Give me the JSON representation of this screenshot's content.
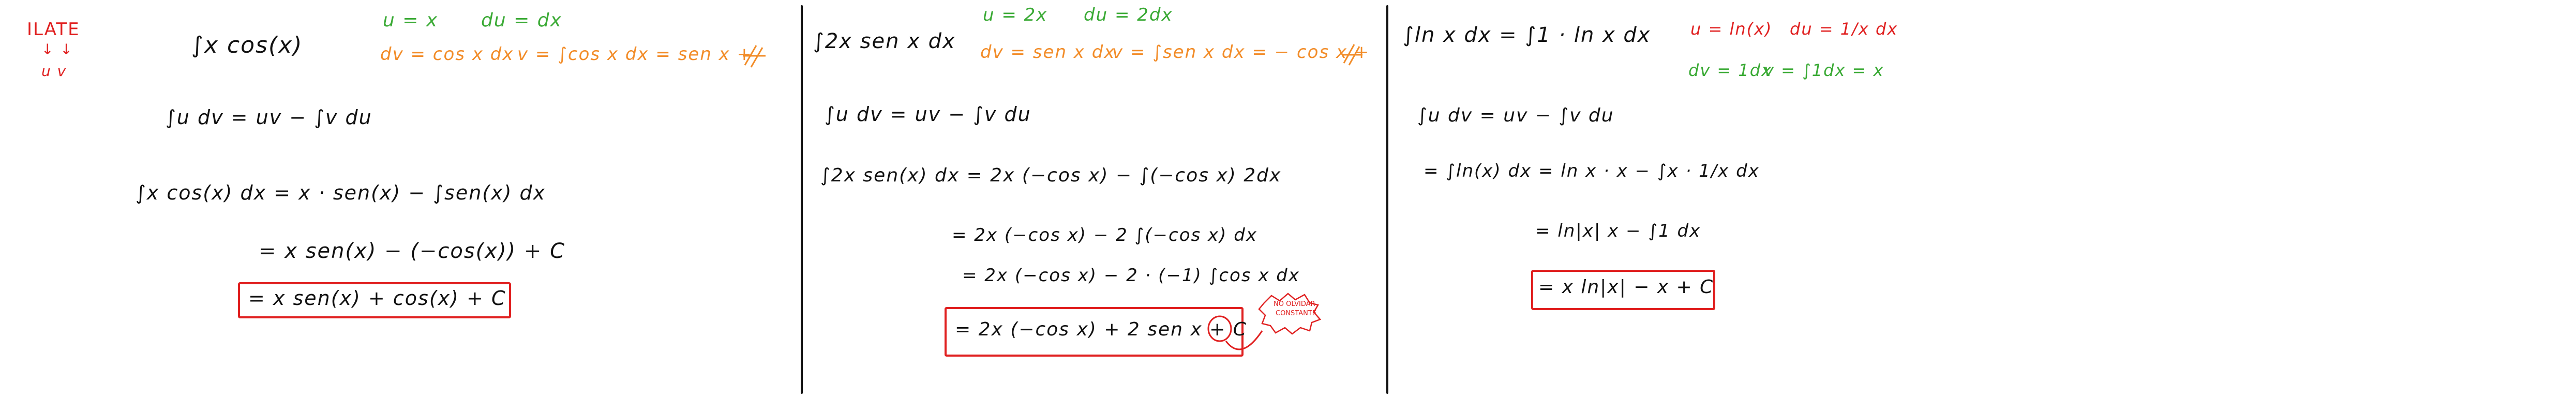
{
  "colors": {
    "ink": "#111111",
    "green": "#3aaa35",
    "orange": "#f28c28",
    "red": "#e02020"
  },
  "ilate": {
    "word": "ILATE",
    "arrows": "↓   ↓",
    "uv": "u   v"
  },
  "panel1": {
    "integral": "∫x cos(x)",
    "u_def": "u = x",
    "du_def": "du = dx",
    "dv_def": "dv = cos x dx",
    "v_def": "v = ∫cos x dx = sen x +",
    "formula": "∫u dv = uv − ∫v du",
    "step1": "∫x cos(x) dx = x · sen(x) − ∫sen(x) dx",
    "step2": "= x sen(x) − (−cos(x)) + C",
    "result": "= x sen(x) + cos(x) + C"
  },
  "panel2": {
    "integral": "∫2x sen x dx",
    "u_def": "u = 2x",
    "du_def": "du = 2dx",
    "dv_def": "dv = sen x dx",
    "v_def": "v = ∫sen x dx = − cos x +",
    "formula": "∫u dv = uv − ∫v du",
    "step1": "∫2x sen(x) dx = 2x (−cos x) − ∫(−cos x) 2dx",
    "step2": "= 2x (−cos x) − 2 ∫(−cos x) dx",
    "step3": "= 2x (−cos x) − 2 · (−1) ∫cos x dx",
    "result": "= 2x (−cos x) + 2 sen x + C",
    "note_line1": "NO OLVIDAR",
    "note_line2": "CONSTANTE"
  },
  "panel3": {
    "integral": "∫ln x dx = ∫1 · ln x dx",
    "u_def": "u = ln(x)",
    "du_def": "du = 1/x dx",
    "dv_def": "dv = 1dx",
    "v_def": "v = ∫1dx = x",
    "formula": "∫u dv = uv − ∫v du",
    "step1": "= ∫ln(x) dx = ln x · x − ∫x · 1/x dx",
    "step2": "= ln|x| x − ∫1 dx",
    "result": "= x ln|x| − x + C"
  }
}
